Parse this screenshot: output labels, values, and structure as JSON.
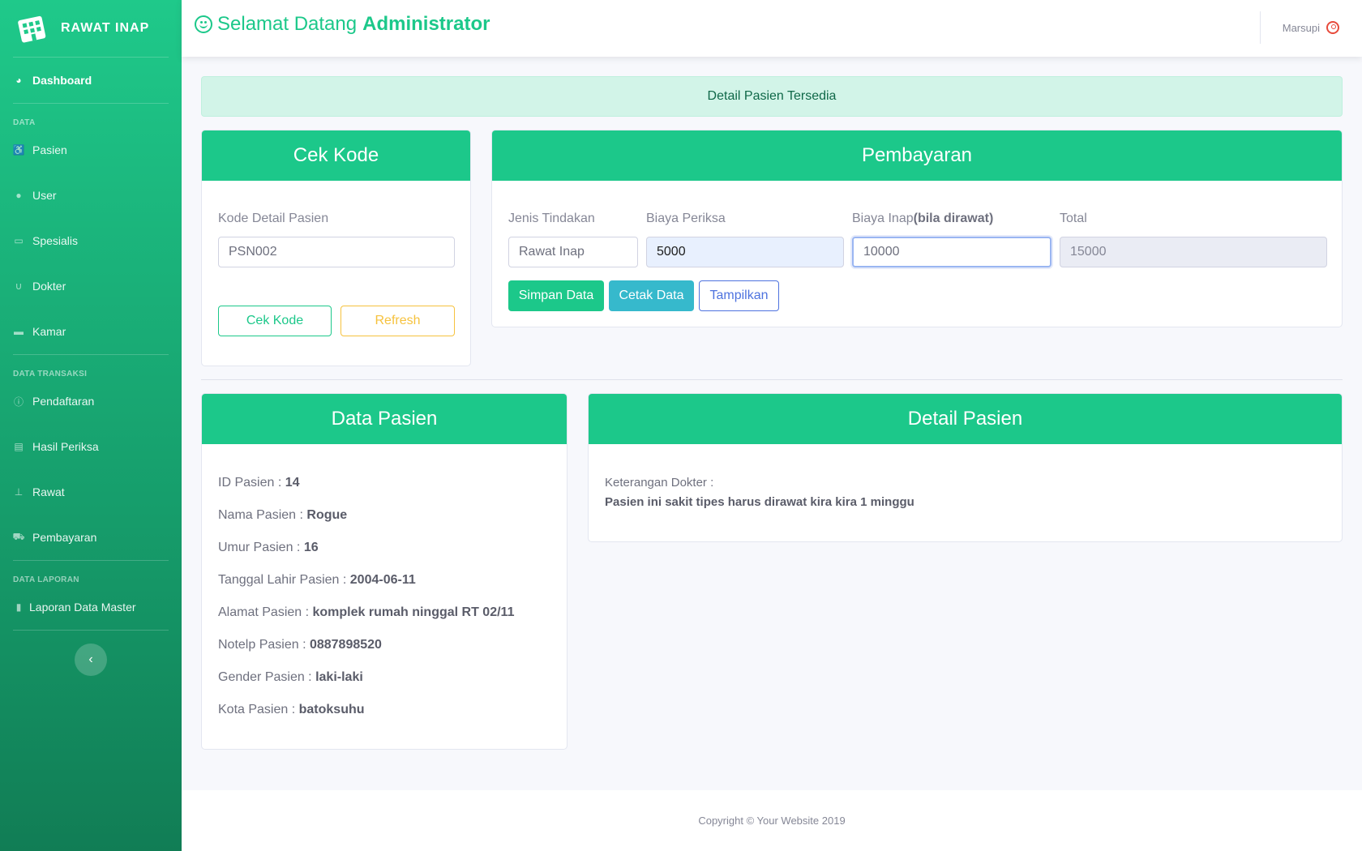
{
  "brand": {
    "title": "RAWAT INAP"
  },
  "sidebar": {
    "dashboard": "Dashboard",
    "heading_data": "DATA",
    "data_items": [
      "Pasien",
      "User",
      "Spesialis",
      "Dokter",
      "Kamar"
    ],
    "heading_transaksi": "DATA TRANSAKSI",
    "transaksi_items": [
      "Pendaftaran",
      "Hasil Periksa",
      "Rawat",
      "Pembayaran"
    ],
    "heading_laporan": "DATA LAPORAN",
    "laporan_items": [
      "Laporan Data Master"
    ],
    "toggle_icon": "‹"
  },
  "topbar": {
    "welcome_prefix": "Selamat Datang",
    "welcome_name": "Administrator",
    "user_name": "Marsupi"
  },
  "alert": {
    "text": "Detail Pasien Tersedia"
  },
  "cek_kode": {
    "title": "Cek Kode",
    "label": "Kode Detail Pasien",
    "value": "PSN002",
    "check_button": "Cek Kode",
    "refresh_button": "Refresh"
  },
  "pembayaran": {
    "title": "Pembayaran",
    "jenis_label": "Jenis Tindakan",
    "jenis_value": "Rawat Inap",
    "biaya_periksa_label": "Biaya Periksa",
    "biaya_periksa_value": "5000",
    "biaya_inap_label": "Biaya Inap",
    "biaya_inap_note": "(bila dirawat)",
    "biaya_inap_value": "10000",
    "total_label": "Total",
    "total_value": "15000",
    "save_button": "Simpan Data",
    "print_button": "Cetak Data",
    "show_button": "Tampilkan"
  },
  "data_pasien": {
    "title": "Data Pasien",
    "rows": [
      {
        "label": "ID Pasien : ",
        "value": "14"
      },
      {
        "label": "Nama Pasien : ",
        "value": "Rogue"
      },
      {
        "label": "Umur Pasien : ",
        "value": "16"
      },
      {
        "label": "Tanggal Lahir Pasien : ",
        "value": "2004-06-11"
      },
      {
        "label": "Alamat Pasien : ",
        "value": "komplek rumah ninggal RT 02/11"
      },
      {
        "label": "Notelp Pasien : ",
        "value": "0887898520"
      },
      {
        "label": "Gender Pasien : ",
        "value": "laki-laki"
      },
      {
        "label": "Kota Pasien : ",
        "value": "batoksuhu"
      }
    ]
  },
  "detail_pasien": {
    "title": "Detail Pasien",
    "keterangan_label": "Keterangan Dokter :",
    "keterangan_value": "Pasien ini sakit tipes harus dirawat kira kira 1 minggu"
  },
  "footer": {
    "text": "Copyright © Your Website 2019"
  },
  "colors": {
    "primary_green": "#1cc88a",
    "info": "#36b9cc",
    "warning": "#f6c23e",
    "primary_blue": "#4e73df"
  }
}
